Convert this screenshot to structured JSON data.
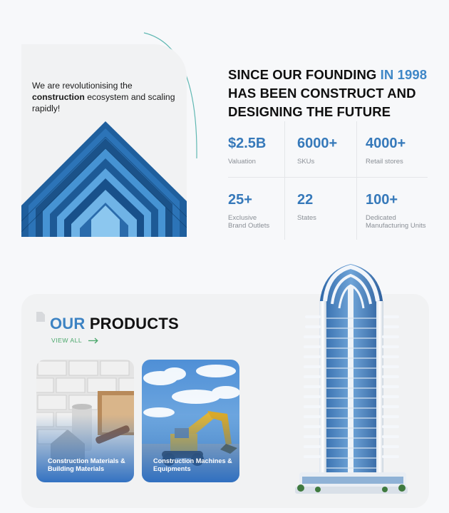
{
  "intro": {
    "text_before": "We are revolutionising the ",
    "text_bold": "construction",
    "text_after": " ecosystem and scaling rapidly!"
  },
  "headline": {
    "part1": "SINCE OUR FOUNDING ",
    "accent": "IN 1998",
    "part2": " HAS BEEN CONSTRUCT AND DESIGNING THE FUTURE"
  },
  "stats": [
    {
      "value": "$2.5B",
      "label": "Valuation"
    },
    {
      "value": "6000+",
      "label": "SKUs"
    },
    {
      "value": "4000+",
      "label": "Retail stores"
    },
    {
      "value": "25+",
      "label": "Exclusive Brand Outlets"
    },
    {
      "value": "22",
      "label": "States"
    },
    {
      "value": "100+",
      "label": "Dedicated Manufacturing Units"
    }
  ],
  "products": {
    "title_accent": "OUR",
    "title_rest": "PRODUCTS",
    "view_all": "VIEW ALL",
    "cards": [
      {
        "label": "Construction Materials & Building Materials"
      },
      {
        "label": "Construction Machines & Equipments"
      }
    ]
  },
  "colors": {
    "accent": "#3d83c3",
    "link_green": "#4aa76b",
    "stat_blue": "#3679ba"
  }
}
